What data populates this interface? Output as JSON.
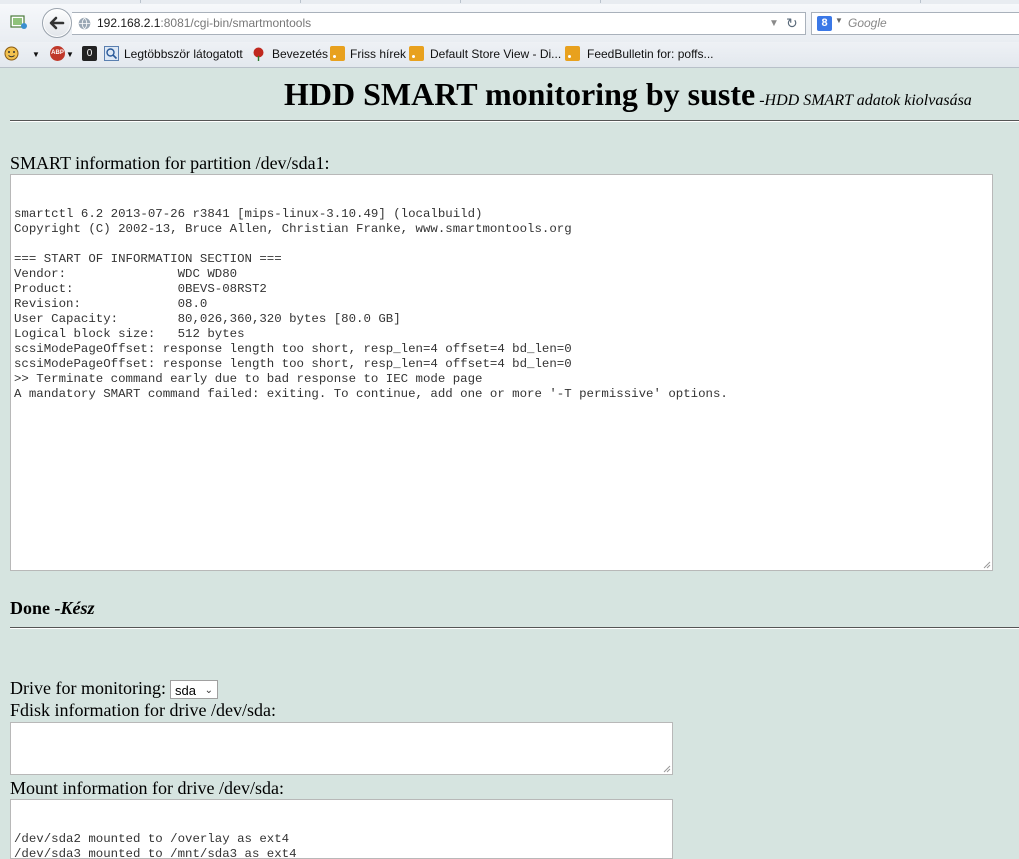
{
  "browser": {
    "url_host": "192.168.2.1",
    "url_rest": ":8081/cgi-bin/smartmontools",
    "search_placeholder": "Google",
    "search_engine_letter": "8",
    "bookmarks": [
      {
        "label": "Legtöbbször látogatott",
        "icon": "magnifier-icon"
      },
      {
        "label": "Bevezetés",
        "icon": "rose-icon"
      },
      {
        "label": "Friss hírek",
        "icon": "rss-icon"
      },
      {
        "label": "Default Store View - Di...",
        "icon": "rss-icon"
      },
      {
        "label": "FeedBulletin for: poffs...",
        "icon": "rss-icon"
      }
    ],
    "addon_badge": "ABP",
    "addon_counter": "0"
  },
  "header": {
    "title": "HDD SMART monitoring by suste",
    "subtitle": "-HDD SMART adatok kiolvasása"
  },
  "smart": {
    "label": "SMART information for partition /dev/sda1:",
    "output": "smartctl 6.2 2013-07-26 r3841 [mips-linux-3.10.49] (localbuild)\nCopyright (C) 2002-13, Bruce Allen, Christian Franke, www.smartmontools.org\n\n=== START OF INFORMATION SECTION ===\nVendor:               WDC WD80\nProduct:              0BEVS-08RST2\nRevision:             08.0\nUser Capacity:        80,026,360,320 bytes [80.0 GB]\nLogical block size:   512 bytes\nscsiModePageOffset: response length too short, resp_len=4 offset=4 bd_len=0\nscsiModePageOffset: response length too short, resp_len=4 offset=4 bd_len=0\n>> Terminate command early due to bad response to IEC mode page\nA mandatory SMART command failed: exiting. To continue, add one or more '-T permissive' options."
  },
  "status": {
    "done": "Done",
    "done_hu": "-Kész"
  },
  "drive": {
    "label": "Drive for monitoring:",
    "selected": "sda"
  },
  "fdisk": {
    "label": "Fdisk information for drive /dev/sda:",
    "output": ""
  },
  "mount": {
    "label": "Mount information for drive /dev/sda:",
    "output": "/dev/sda2 mounted to /overlay as ext4\n/dev/sda3 mounted to /mnt/sda3 as ext4"
  }
}
